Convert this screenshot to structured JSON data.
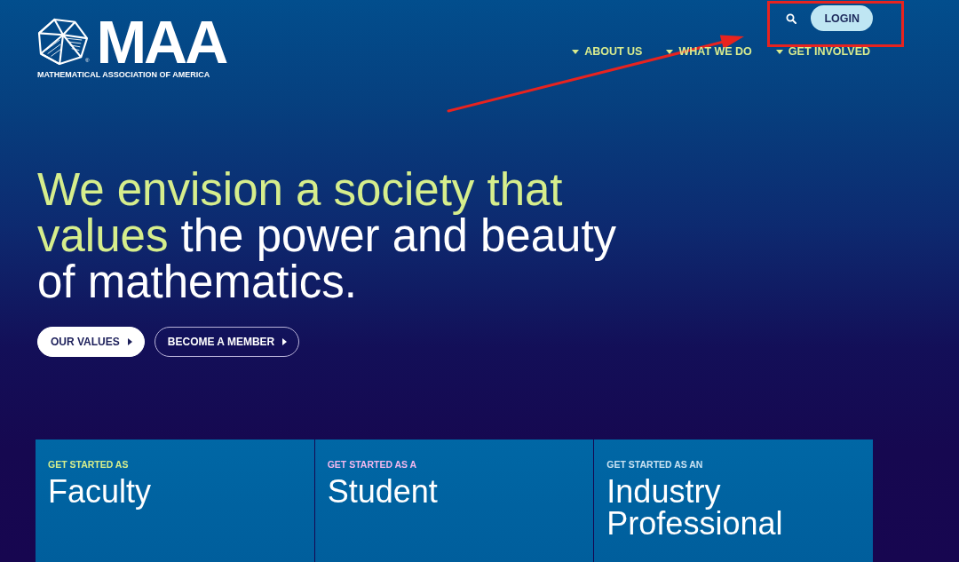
{
  "header": {
    "logo": {
      "wordmark": "MAA",
      "registered_mark": "®",
      "tagline": "MATHEMATICAL ASSOCIATION OF AMERICA"
    },
    "login_button": "LOGIN",
    "nav": [
      {
        "label": "ABOUT US"
      },
      {
        "label": "WHAT WE DO"
      },
      {
        "label": "GET INVOLVED"
      }
    ]
  },
  "hero": {
    "headline_highlight": "We envision a society that values",
    "headline_rest": "the power and beauty of mathematics.",
    "buttons": [
      {
        "label": "OUR VALUES",
        "kind": "solid"
      },
      {
        "label": "BECOME A MEMBER",
        "kind": "outline"
      }
    ]
  },
  "cards": [
    {
      "eyebrow": "GET STARTED AS",
      "title": "Faculty",
      "color": "#d6ee8c"
    },
    {
      "eyebrow": "GET STARTED AS A",
      "title": "Student",
      "color": "#f2b8ee"
    },
    {
      "eyebrow": "GET STARTED AS AN",
      "title": "Industry Professional",
      "color": "#c9e2f2"
    }
  ],
  "annotations": {
    "arrow": true,
    "highlight_frame": true
  }
}
